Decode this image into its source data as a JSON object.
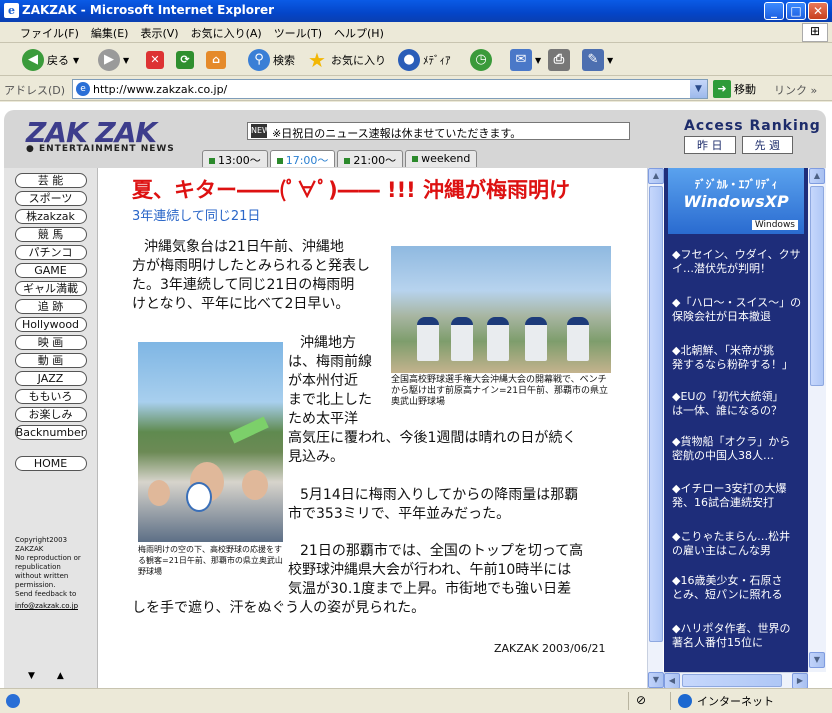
{
  "window": {
    "title": "ZAKZAK - Microsoft Internet Explorer"
  },
  "menu": [
    "ファイル(F)",
    "編集(E)",
    "表示(V)",
    "お気に入り(A)",
    "ツール(T)",
    "ヘルプ(H)"
  ],
  "toolbar": {
    "back": "戻る",
    "search": "検索",
    "favorites": "お気に入り",
    "media": "ﾒﾃﾞｨｱ"
  },
  "address": {
    "label": "アドレス(D)",
    "url": "http://www.zakzak.co.jp/",
    "go": "移動",
    "links": "リンク"
  },
  "site": {
    "logo": "ZAK ZAK",
    "logo_sub": "ENTERTAINMENT NEWS",
    "notice": "※日祝日のニュース速報は休ませていただきます。",
    "time_tabs": [
      "13:00〜",
      "17:00〜",
      "21:00〜",
      "weekend"
    ],
    "active_time_tab": "17:00〜",
    "ranking_title": "Access Ranking",
    "ranking_tabs": [
      "昨 日",
      "先 週"
    ]
  },
  "nav": [
    "芸 能",
    "スポーツ",
    "株zakzak",
    "競 馬",
    "パチンコ",
    "GAME",
    "ギャル満載",
    "追 跡",
    "Hollywood",
    "映 画",
    "動 画",
    "JAZZ",
    "ももいろ",
    "お楽しみ",
    "Backnumber"
  ],
  "nav_home": "HOME",
  "copyright": [
    "Copyright2003",
    "ZAKZAK",
    "No reproduction or",
    "republication",
    "without written",
    "permission.",
    "Send feedback to"
  ],
  "copyright_mail": "info@zakzak.co.jp",
  "article": {
    "headline": "夏、キター――(ﾟ∀ﾟ)―― !!! 沖縄が梅雨明け",
    "subhead": "3年連続して同じ21日",
    "p1_lines": [
      "沖縄気象台は21日午前、沖縄地",
      "方が梅雨明けしたとみられると発表し",
      "た。3年連続して同じ21日の梅雨明",
      "けとなり、平年に比べて2日早い。"
    ],
    "p2_lines": [
      "沖縄地方",
      "は、梅雨前線",
      "が本州付近",
      "まで北上した",
      "ため太平洋"
    ],
    "p2_rest": [
      "高気圧に覆われ、今後1週間は晴れの日が続く",
      "見込み。"
    ],
    "p3_lines": [
      "5月14日に梅雨入りしてからの降雨量は那覇",
      "市で353ミリで、平年並みだった。"
    ],
    "p4_lines": [
      "21日の那覇市では、全国のトップを切って高",
      "校野球沖縄県大会が行われ、午前10時半には",
      "気温が30.1度まで上昇。市街地でも強い日差",
      "しを手で遮り、汗をぬぐう人の姿が見られた。"
    ],
    "photo1_caption": "全国高校野球選手権大会沖縄大会の開幕戦で、ベンチから駆け出す前原高ナイン=21日午前、那覇市の県立奥武山野球場",
    "photo2_caption": "梅雨明けの空の下、高校野球の応援をする観客=21日午前、那覇市の県立奥武山野球場",
    "byline": "ZAKZAK 2003/06/21"
  },
  "ad": {
    "line1": "ﾃﾞｼﾞｶﾙ・ｴﾌﾞﾘﾃﾞｨ",
    "line2": "WindowsXP",
    "line3": "Windows"
  },
  "ranking": [
    [
      "◆フセイン、ウダイ、クサ",
      "イ…潜伏先が判明！"
    ],
    [
      "◆「ハロ〜・スイス〜」の",
      "保険会社が日本撤退"
    ],
    [
      "◆北朝鮮、「米帝が挑",
      "発するなら粉砕する！」"
    ],
    [
      "◆EUの「初代大統領」",
      "は一体、誰になるの？"
    ],
    [
      "◆貨物船「オクラ」から",
      "密航の中国人38人…"
    ],
    [
      "◆イチロー3安打の大爆",
      "発、16試合連続安打"
    ],
    [
      "◆こりゃたまらん…松井",
      "の雇い主はこんな男"
    ],
    [
      "◆16歳美少女・石原さ",
      "とみ、短パンに照れる"
    ],
    [
      "◆ハリポタ作者、世界の",
      "著名人番付15位に"
    ]
  ],
  "status": {
    "zone": "インターネット"
  }
}
